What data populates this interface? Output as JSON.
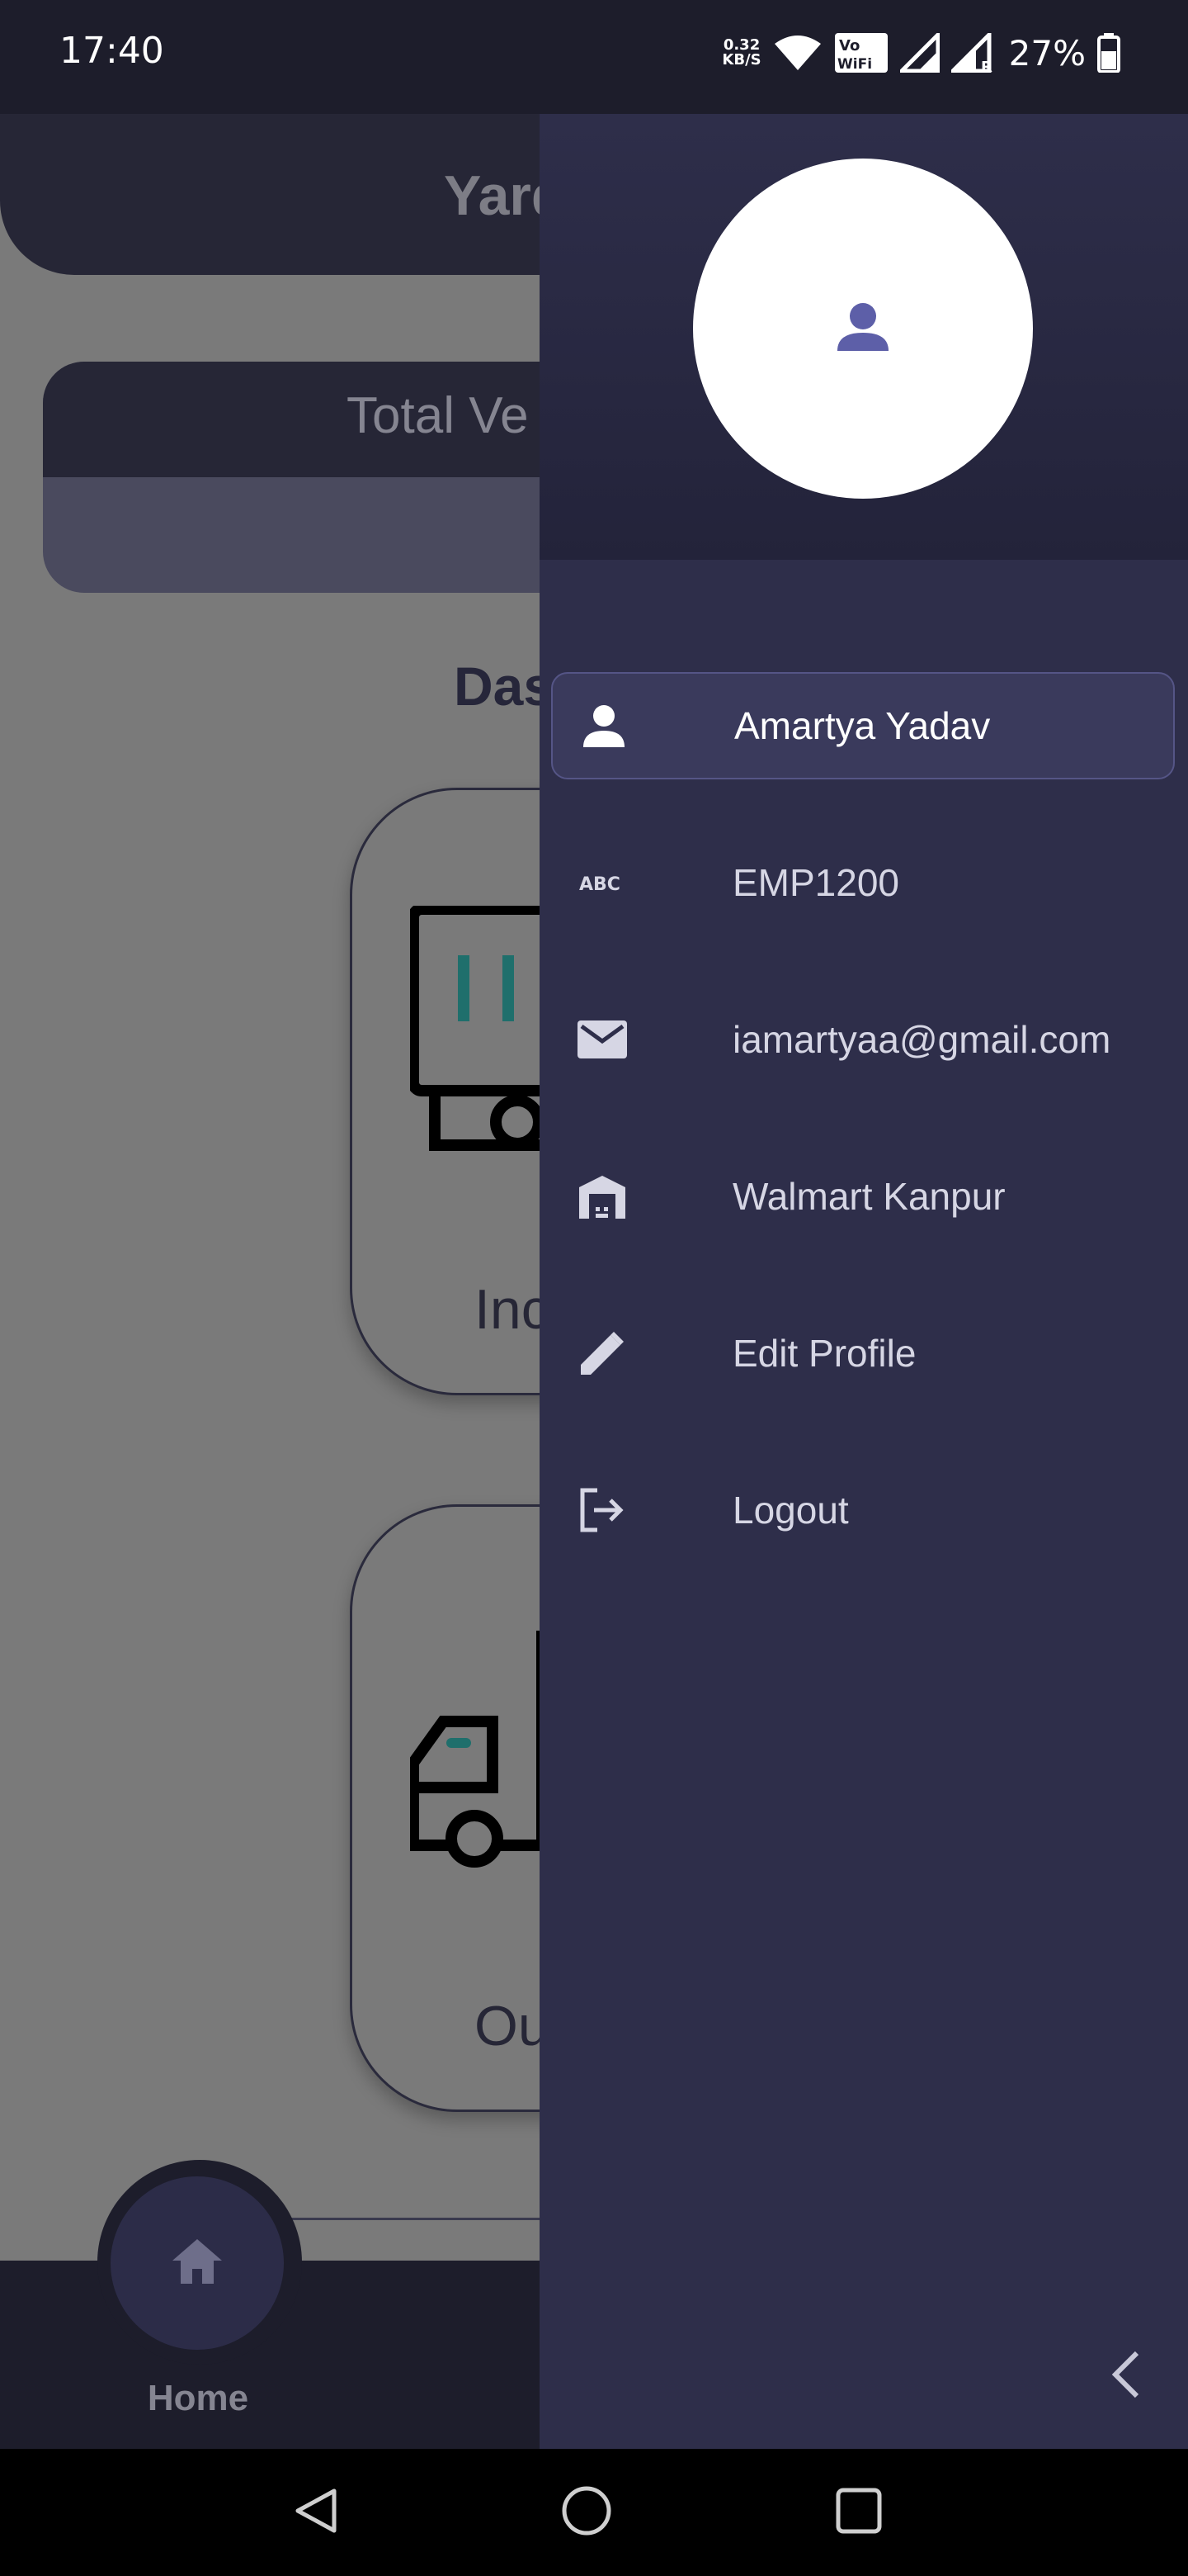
{
  "status_bar": {
    "time": "17:40",
    "net_speed_value": "0.32",
    "net_speed_unit": "KB/S",
    "vowifi_top": "Vo",
    "vowifi_bottom": "WiFi",
    "roaming_badge": "R",
    "battery": "27%",
    "icons": [
      "wifi-icon",
      "vowifi-icon",
      "signal-icon",
      "signal-roaming-icon",
      "battery-icon"
    ]
  },
  "background_app": {
    "title": "Yard",
    "total_card_label": "Total Ve",
    "dashboard_title": "Das",
    "tiles": [
      {
        "label": "Inc",
        "icon": "inbound-vehicle-icon"
      },
      {
        "label": "Ou",
        "icon": "outbound-truck-icon"
      }
    ],
    "bottom_nav": {
      "home_label": "Home",
      "home_icon": "home-icon"
    }
  },
  "drawer": {
    "avatar_icon": "user-avatar-icon",
    "menu": [
      {
        "label": "Amartya Yadav",
        "icon": "person-icon",
        "active": true
      },
      {
        "label": "EMP1200",
        "icon": "abc-icon",
        "icon_text": "ABC",
        "active": false
      },
      {
        "label": "iamartyaa@gmail.com",
        "icon": "mail-icon",
        "active": false
      },
      {
        "label": "Walmart Kanpur",
        "icon": "warehouse-icon",
        "active": false
      },
      {
        "label": "Edit Profile",
        "icon": "edit-icon",
        "active": false
      },
      {
        "label": "Logout",
        "icon": "logout-icon",
        "active": false
      }
    ],
    "collapse_icon": "chevron-left-icon"
  },
  "system_nav": [
    "back-icon",
    "home-circle-icon",
    "recents-icon"
  ],
  "colors": {
    "drawer_bg": "#2e2e4a",
    "accent": "#5d5fa8",
    "active_item_bg": "#3a3a5c",
    "text_light": "#d6d6e4"
  }
}
